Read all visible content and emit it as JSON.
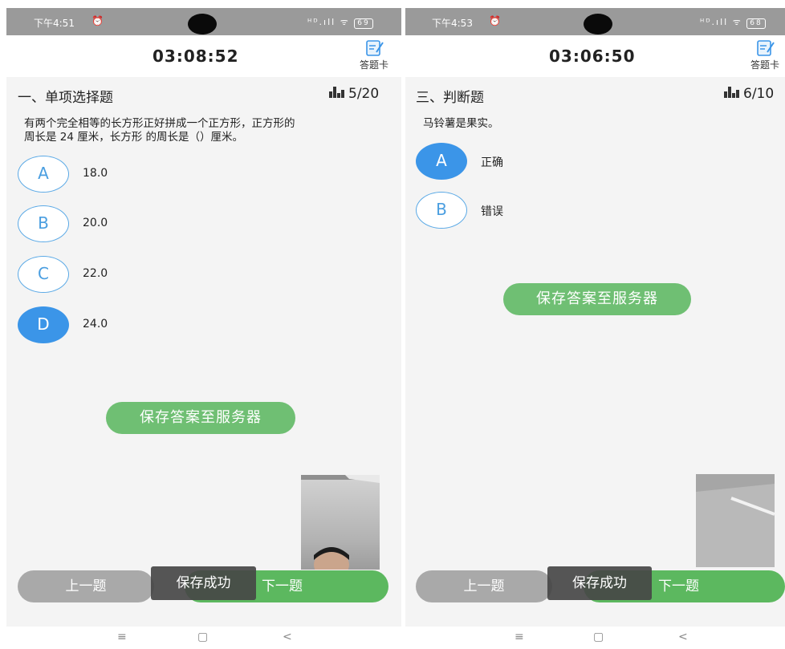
{
  "left": {
    "status": {
      "time": "下午4:51",
      "alarm": "⏰",
      "battery": "69"
    },
    "timer": "03:08:52",
    "answer_card_label": "答题卡",
    "section_title": "一、单项选择题",
    "progress": "5/20",
    "question": [
      "有两个完全相等的长方形正好拼成一个正方形，正方形的",
      "周长是 24 厘米，长方形 的周长是（）厘米。"
    ],
    "options": [
      {
        "letter": "A",
        "text": "18.0"
      },
      {
        "letter": "B",
        "text": "20.0"
      },
      {
        "letter": "C",
        "text": "22.0"
      },
      {
        "letter": "D",
        "text": "24.0"
      }
    ],
    "selected": "D",
    "save_button": "保存答案至服务器",
    "prev_button": "上一题",
    "next_button": "下一题",
    "toast": "保存成功"
  },
  "right": {
    "status": {
      "time": "下午4:53",
      "alarm": "⏰",
      "battery": "68"
    },
    "timer": "03:06:50",
    "answer_card_label": "答题卡",
    "section_title": "三、判断题",
    "progress": "6/10",
    "question": [
      "马铃薯是果实。"
    ],
    "options": [
      {
        "letter": "A",
        "text": "正确"
      },
      {
        "letter": "B",
        "text": "错误"
      }
    ],
    "selected": "A",
    "save_button": "保存答案至服务器",
    "prev_button": "上一题",
    "next_button": "下一题",
    "toast": "保存成功"
  },
  "system_nav": {
    "menu": "≡",
    "home": "▢",
    "back": "<"
  },
  "signal_icons": "ᴴᴰ.ıll ᯤ",
  "colors": {
    "accent": "#3b95e8",
    "save_green": "#6fbf73",
    "next_green": "#5cb85f",
    "prev_gray": "#a9a9a9"
  }
}
